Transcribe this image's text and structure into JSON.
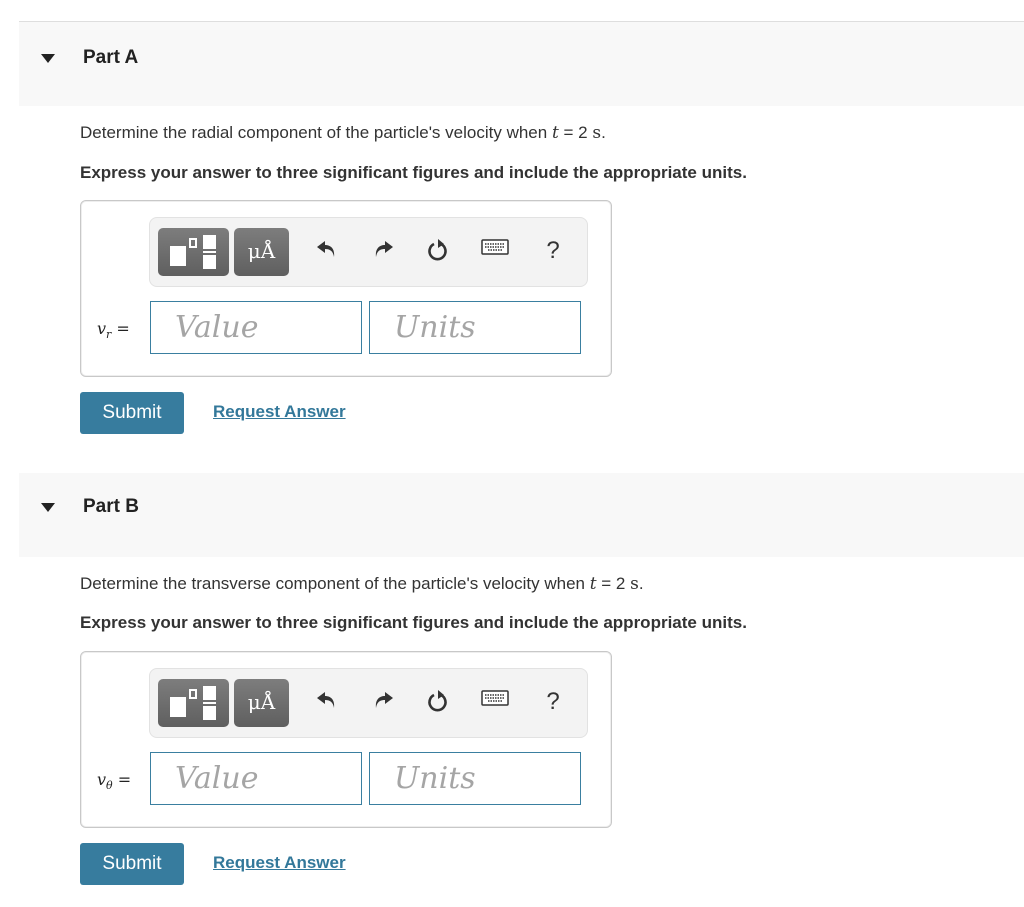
{
  "parts": [
    {
      "title": "Part A",
      "question_prefix": "Determine the radial component of the particle's velocity when ",
      "time_var": "t",
      "time_eq": " = 2 ",
      "time_unit": "s",
      "time_end": ".",
      "instruction": "Express your answer to three significant figures and include the appropriate units.",
      "variable": "v",
      "subscript": "r",
      "equals": "=",
      "value_placeholder": "Value",
      "units_placeholder": "Units",
      "submit_label": "Submit",
      "request_label": "Request Answer"
    },
    {
      "title": "Part B",
      "question_prefix": "Determine the transverse component of the particle's velocity when ",
      "time_var": "t",
      "time_eq": " = 2 ",
      "time_unit": "s",
      "time_end": ".",
      "instruction": "Express your answer to three significant figures and include the appropriate units.",
      "variable": "v",
      "subscript": "θ",
      "equals": "=",
      "value_placeholder": "Value",
      "units_placeholder": "Units",
      "submit_label": "Submit",
      "request_label": "Request Answer"
    }
  ],
  "toolbar": {
    "symbols_label": "μÅ",
    "help_label": "?",
    "icons": [
      "templates-icon",
      "symbols-icon",
      "undo-icon",
      "redo-icon",
      "reset-icon",
      "keyboard-icon",
      "help-icon"
    ]
  },
  "colors": {
    "accent": "#377c9e",
    "link": "#33789a",
    "input_border": "#3a7fa0",
    "header_bg": "#f8f8f8"
  }
}
